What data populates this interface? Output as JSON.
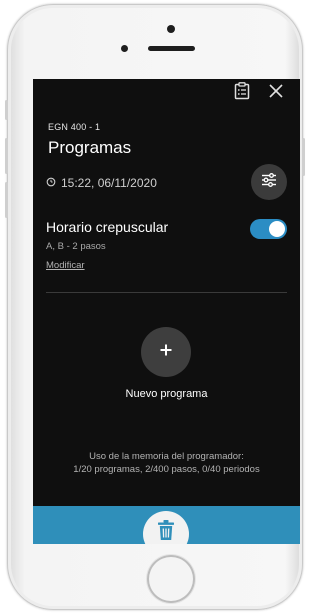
{
  "device": {
    "name": "EGN 400 - 1"
  },
  "page": {
    "title": "Programas"
  },
  "header": {
    "datetime": "15:22, 06/11/2020"
  },
  "programs": [
    {
      "name": "Horario crepuscular",
      "detail": "A, B  -  2 pasos",
      "modify_label": "Modificar",
      "enabled": true
    }
  ],
  "actions": {
    "new_program_label": "Nuevo programa"
  },
  "memory": {
    "line1": "Uso de la memoria del programador:",
    "line2": "1/20 programas, 2/400 pasos, 0/40 periodos"
  },
  "colors": {
    "accent": "#2b8dc4",
    "bottom_bar": "#2f8fba",
    "screen_bg": "#0f0f0f"
  },
  "icons": {
    "top_right": [
      "clipboard-list-icon",
      "close-icon"
    ],
    "clock": "clock-icon",
    "settings": "sliders-icon",
    "add": "plus-icon",
    "delete": "trash-icon"
  }
}
